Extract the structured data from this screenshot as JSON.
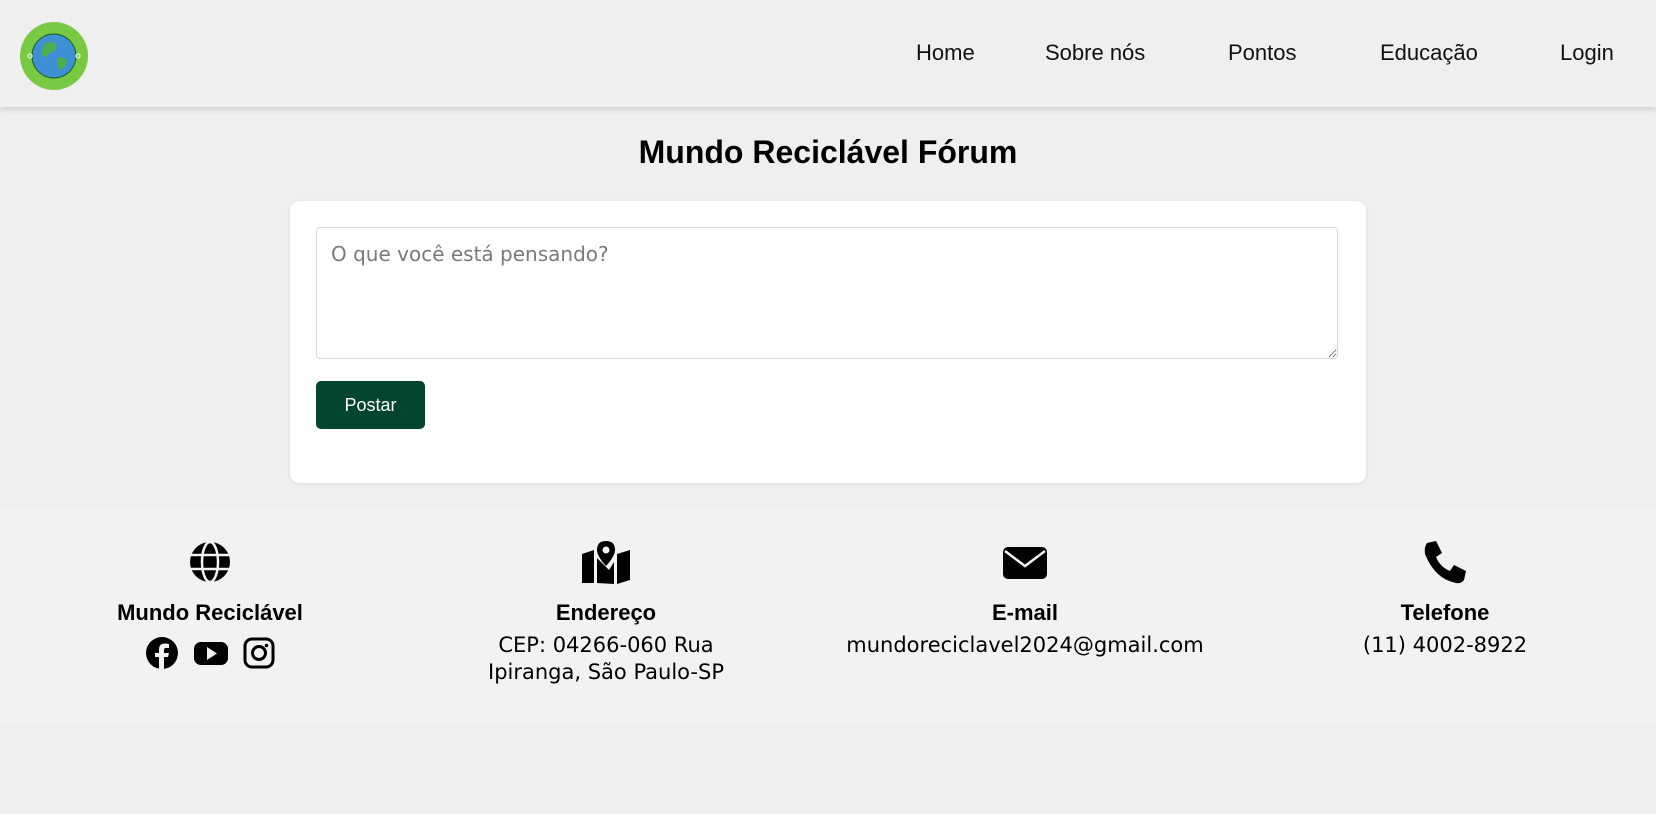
{
  "header": {
    "logo_alt": "Mundo Reciclável",
    "nav": [
      {
        "label": "Home"
      },
      {
        "label": "Sobre nós"
      },
      {
        "label": "Pontos"
      },
      {
        "label": "Educação"
      },
      {
        "label": "Login"
      }
    ]
  },
  "main": {
    "title": "Mundo Reciclável Fórum",
    "post": {
      "placeholder": "O que você está pensando?",
      "value": "",
      "button_label": "Postar"
    }
  },
  "footer": {
    "brand": {
      "icon": "globe-icon",
      "heading": "Mundo Reciclável",
      "social": [
        "facebook-icon",
        "youtube-icon",
        "instagram-icon"
      ]
    },
    "address": {
      "icon": "map-icon",
      "heading": "Endereço",
      "line1": "CEP: 04266-060 Rua",
      "line2": "Ipiranga, São Paulo-SP"
    },
    "email": {
      "icon": "envelope-icon",
      "heading": "E-mail",
      "value": "mundoreciclavel2024@gmail.com"
    },
    "phone": {
      "icon": "phone-icon",
      "heading": "Telefone",
      "value": "(11) 4002-8922"
    }
  },
  "colors": {
    "page_bg": "#efefef",
    "button_bg": "#03452f",
    "footer_bg": "#f1f2f4",
    "logo_green": "#7ac943"
  }
}
